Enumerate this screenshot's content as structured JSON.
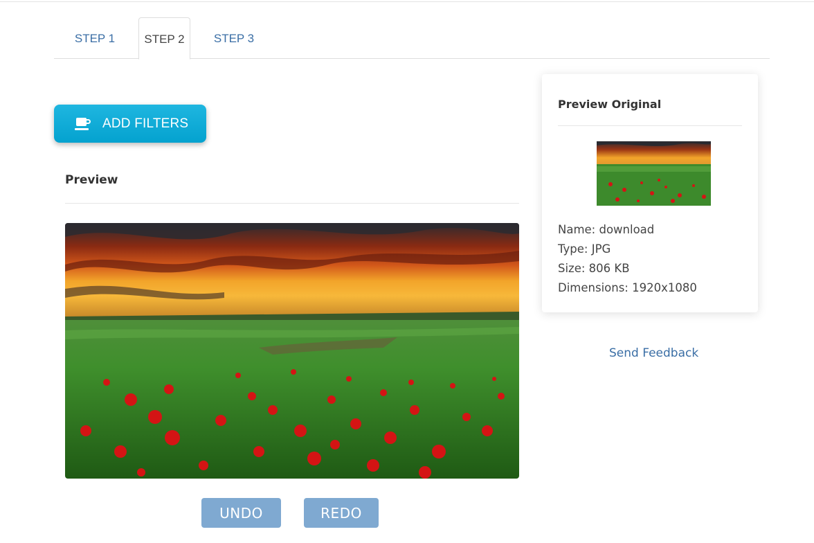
{
  "tabs": [
    {
      "label": "STEP 1",
      "active": false
    },
    {
      "label": "STEP 2",
      "active": true
    },
    {
      "label": "STEP 3",
      "active": false
    }
  ],
  "toolbar": {
    "add_filters_label": "ADD FILTERS",
    "add_filters_icon": "coffee-cup-icon"
  },
  "preview": {
    "title": "Preview",
    "image": "poppy-field-sunset-image"
  },
  "actions": {
    "undo_label": "UNDO",
    "redo_label": "REDO"
  },
  "original": {
    "title": "Preview Original",
    "name": "Name: download",
    "type": "Type: JPG",
    "size": "Size: 806 KB",
    "dimensions": "Dimensions: 1920x1080"
  },
  "feedback_label": "Send Feedback",
  "colors": {
    "accent": "#04a2cf",
    "link": "#3a6ea5",
    "button_muted": "#7fa9d1"
  }
}
